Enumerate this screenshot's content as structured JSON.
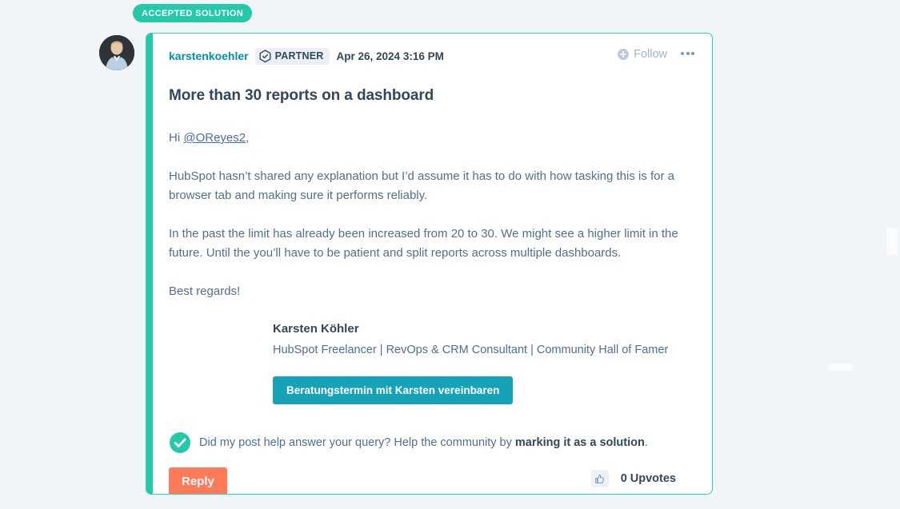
{
  "badge": {
    "accepted_solution_label": "ACCEPTED SOLUTION"
  },
  "post": {
    "author": "karstenkoehler",
    "author_badge_label": "PARTNER",
    "author_badge_icon": "hexagon-check-icon",
    "date": "Apr 26, 2024 3:16 PM",
    "follow_label": "Follow",
    "follow_icon": "plus-circle-icon",
    "more_icon": "ellipsis-icon",
    "avatar_icon": "user-avatar-photo",
    "title": "More than 30 reports on a dashboard",
    "body": {
      "greeting_prefix": "Hi ",
      "greeting_mention": "@OReyes2",
      "greeting_suffix": ",",
      "paragraph_1": "HubSpot hasn’t shared any explanation but I’d assume it has to do with how tasking this is for a browser tab and making sure it performs reliably.",
      "paragraph_2": "In the past the limit has already been increased from 20 to 30. We might see a higher limit in the future. Until the you’ll have to be patient and split reports across multiple dashboards.",
      "closing": "Best regards!"
    },
    "signature": {
      "name": "Karsten Köhler",
      "role": "HubSpot Freelancer | RevOps & CRM Consultant | Community Hall of Famer",
      "cta_label": "Beratungstermin mit Karsten vereinbaren"
    },
    "solution_prompt": {
      "icon": "check-circle-icon",
      "text_before": "Did my post help answer your query? Help the community by ",
      "text_bold": "marking it as a solution",
      "text_after": "."
    },
    "footer": {
      "reply_label": "Reply",
      "upvote_icon": "thumbs-up-icon",
      "upvote_count_label": "0 Upvotes"
    }
  },
  "colors": {
    "page_background": "#f2f5f8",
    "accent_teal": "#25c9a9",
    "card_border": "#2dd4b4",
    "author_link": "#0091ae",
    "heading_navy": "#33475b",
    "body_text": "#516f90",
    "mention_blue": "#4b6bab",
    "cta_teal": "#17a2b8",
    "reply_coral": "#ff7a59",
    "badge_pill_bg": "#eaf0f6"
  }
}
